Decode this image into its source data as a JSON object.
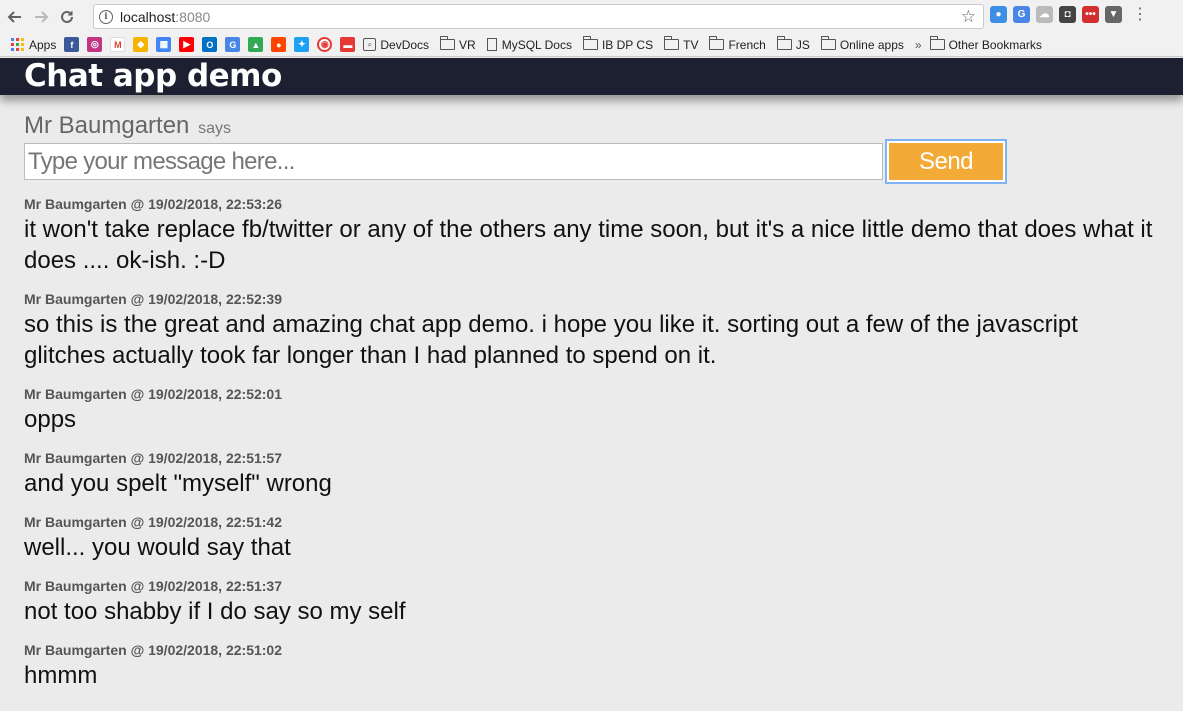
{
  "browser": {
    "url_host": "localhost",
    "url_port": ":8080",
    "bookmarks": {
      "apps_label": "Apps",
      "devdocs": "DevDocs",
      "vr": "VR",
      "mysql_docs": "MySQL Docs",
      "ib_dp_cs": "IB DP CS",
      "tv": "TV",
      "french": "French",
      "js": "JS",
      "online_apps": "Online apps",
      "overflow": "»",
      "other_bookmarks": "Other Bookmarks"
    }
  },
  "app": {
    "title": "Chat app demo",
    "user_name": "Mr Baumgarten",
    "says_label": "says",
    "input_placeholder": "Type your message here...",
    "send_label": "Send"
  },
  "messages": [
    {
      "meta": "Mr Baumgarten @ 19/02/2018, 22:53:26",
      "text": "it won't take replace fb/twitter or any of the others any time soon, but it's a nice little demo that does what it does .... ok-ish. :-D"
    },
    {
      "meta": "Mr Baumgarten @ 19/02/2018, 22:52:39",
      "text": "so this is the great and amazing chat app demo. i hope you like it. sorting out a few of the javascript glitches actually took far longer than I had planned to spend on it."
    },
    {
      "meta": "Mr Baumgarten @ 19/02/2018, 22:52:01",
      "text": "opps"
    },
    {
      "meta": "Mr Baumgarten @ 19/02/2018, 22:51:57",
      "text": "and you spelt \"myself\" wrong"
    },
    {
      "meta": "Mr Baumgarten @ 19/02/2018, 22:51:42",
      "text": "well... you would say that"
    },
    {
      "meta": "Mr Baumgarten @ 19/02/2018, 22:51:37",
      "text": "not too shabby if I do say so my self"
    },
    {
      "meta": "Mr Baumgarten @ 19/02/2018, 22:51:02",
      "text": "hmmm"
    }
  ]
}
